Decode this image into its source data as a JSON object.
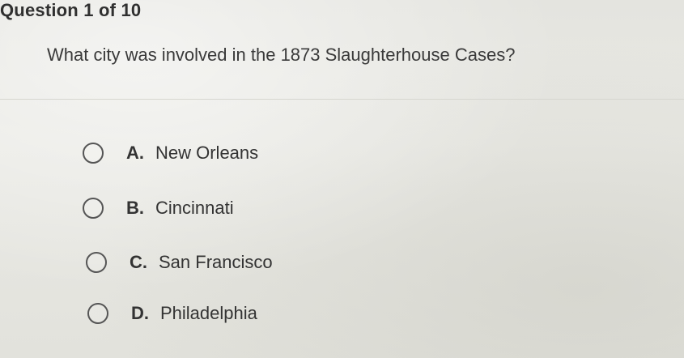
{
  "question": {
    "header": "Question 1 of 10",
    "prompt": "What city was involved in the 1873 Slaughterhouse Cases?"
  },
  "options": [
    {
      "letter": "A.",
      "text": "New Orleans",
      "selected": false
    },
    {
      "letter": "B.",
      "text": "Cincinnati",
      "selected": false
    },
    {
      "letter": "C.",
      "text": "San Francisco",
      "selected": false
    },
    {
      "letter": "D.",
      "text": "Philadelphia",
      "selected": false
    }
  ]
}
